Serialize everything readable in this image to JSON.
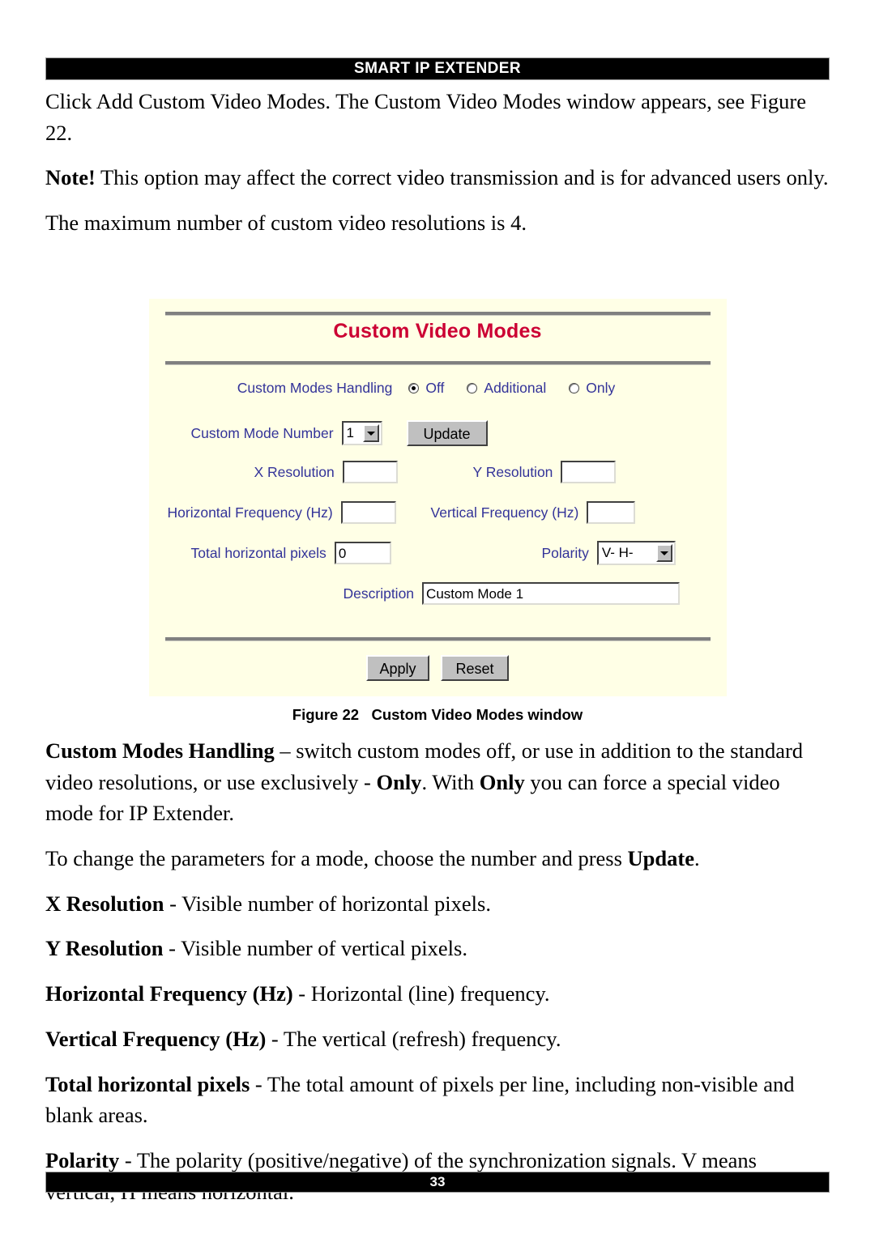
{
  "header": {
    "title": "SMART IP EXTENDER"
  },
  "footer": {
    "page_number": "33"
  },
  "colors": {
    "title_red": "#cc0033",
    "label_blue": "#333399",
    "panel_background": "#ffffe6",
    "button_face": "#c0c0c0",
    "header_background": "#000000"
  },
  "body_top": {
    "p1": "Click Add Custom Video Modes. The Custom Video Modes window appears, see Figure 22.",
    "p2_bold": "Note!",
    "p2_rest": " This option may affect the correct video transmission and is for advanced users only.",
    "p3": "The maximum number of custom video resolutions is 4."
  },
  "figure": {
    "caption_label": "Figure 22",
    "caption_text": "Custom Video Modes window",
    "window": {
      "title": "Custom Video Modes",
      "handling": {
        "label": "Custom Modes Handling",
        "options": [
          {
            "label": "Off",
            "selected": true
          },
          {
            "label": "Additional",
            "selected": false
          },
          {
            "label": "Only",
            "selected": false
          }
        ]
      },
      "mode_number": {
        "label": "Custom Mode Number",
        "value": "1"
      },
      "update_button": "Update",
      "x_resolution": {
        "label": "X Resolution",
        "value": ""
      },
      "y_resolution": {
        "label": "Y Resolution",
        "value": ""
      },
      "horizontal_frequency": {
        "label": "Horizontal Frequency (Hz)",
        "value": ""
      },
      "vertical_frequency": {
        "label": "Vertical Frequency (Hz)",
        "value": ""
      },
      "total_horizontal_pixels": {
        "label": "Total horizontal pixels",
        "value": "0"
      },
      "polarity": {
        "label": "Polarity",
        "value": "V- H-"
      },
      "description": {
        "label": "Description",
        "value": "Custom Mode 1"
      },
      "apply_button": "Apply",
      "reset_button": "Reset"
    }
  },
  "body_bottom": {
    "handling": {
      "term": "Custom Modes Handling",
      "text_a": " – switch custom modes off, or use in addition to the standard video resolutions, or use exclusively - ",
      "only_1": "Only",
      "text_b": ". With ",
      "only_2": "Only",
      "text_c": " you can force a special video mode for IP Extender."
    },
    "change_params": {
      "text_a": "To change the parameters for a mode, choose the number and press ",
      "update": "Update",
      "text_b": "."
    },
    "x_resolution": {
      "term": "X Resolution",
      "text": " - Visible number of horizontal pixels."
    },
    "y_resolution": {
      "term": "Y Resolution",
      "text": " - Visible number of vertical pixels."
    },
    "horizontal_frequency": {
      "term": "Horizontal Frequency (Hz)",
      "text": " - Horizontal (line) frequency."
    },
    "vertical_frequency": {
      "term": "Vertical Frequency (Hz)",
      "text": " - The vertical (refresh) frequency."
    },
    "total_horizontal_pixels": {
      "term": "Total horizontal pixels",
      "text": " - The total amount of pixels per line, including non-visible and blank areas."
    },
    "polarity": {
      "term": "Polarity",
      "text": " - The polarity (positive/negative) of the synchronization signals. V means vertical, H means horizontal."
    }
  }
}
